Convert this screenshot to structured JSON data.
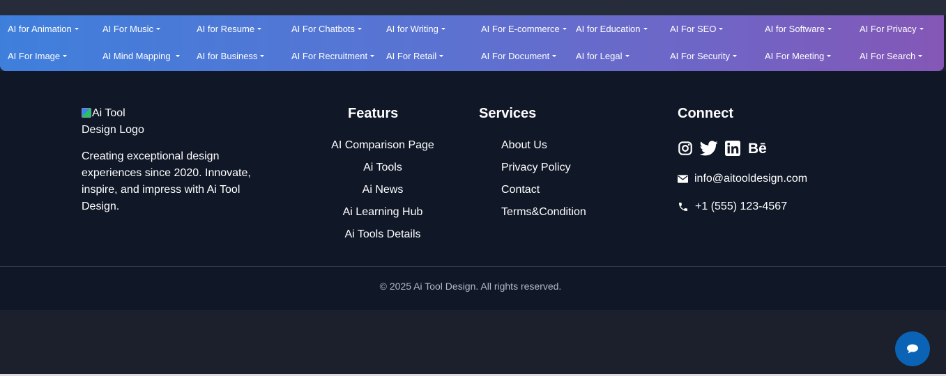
{
  "categories": {
    "row1": [
      {
        "label": "AI for Animation"
      },
      {
        "label": "AI For Music"
      },
      {
        "label": "AI for Resume"
      },
      {
        "label": "AI For Chatbots"
      },
      {
        "label": "AI for Writing"
      },
      {
        "label": "AI For E-commerce"
      },
      {
        "label": "AI for Education"
      },
      {
        "label": "AI For SEO"
      },
      {
        "label": "AI for Software"
      },
      {
        "label": "AI For Privacy"
      }
    ],
    "row2": [
      {
        "label": "AI For Image"
      },
      {
        "label": "AI Mind Mapping"
      },
      {
        "label": "AI for Business"
      },
      {
        "label": "AI For Recruitment"
      },
      {
        "label": "AI For Retail"
      },
      {
        "label": "AI For Document"
      },
      {
        "label": "AI for Legal"
      },
      {
        "label": "AI For Security"
      },
      {
        "label": "AI For Meeting"
      },
      {
        "label": "AI For Search"
      }
    ]
  },
  "footer": {
    "logo_alt_line1": "Ai Tool",
    "logo_alt_line2": "Design Logo",
    "about": "Creating exceptional design experiences since 2020. Innovate, inspire, and impress with Ai Tool Design.",
    "features": {
      "title": "Featurs",
      "links": [
        "AI Comparison Page",
        "Ai Tools",
        "Ai News",
        "Ai Learning Hub",
        "Ai Tools Details"
      ]
    },
    "services": {
      "title": "Services",
      "links": [
        "About Us",
        "Privacy Policy",
        "Contact",
        "Terms&Condition"
      ]
    },
    "connect": {
      "title": "Connect",
      "social_icons": [
        "instagram-icon",
        "twitter-icon",
        "linkedin-icon",
        "behance-icon"
      ],
      "email": "info@aitooldesign.com",
      "phone": "+1 (555) 123-4567"
    },
    "copyright": "© 2025 Ai Tool Design. All rights reserved."
  },
  "colors": {
    "gradient_start": "#3f7fdc",
    "gradient_end": "#8457b6",
    "footer_bg": "#101727",
    "chat_button": "#0b63b5"
  }
}
